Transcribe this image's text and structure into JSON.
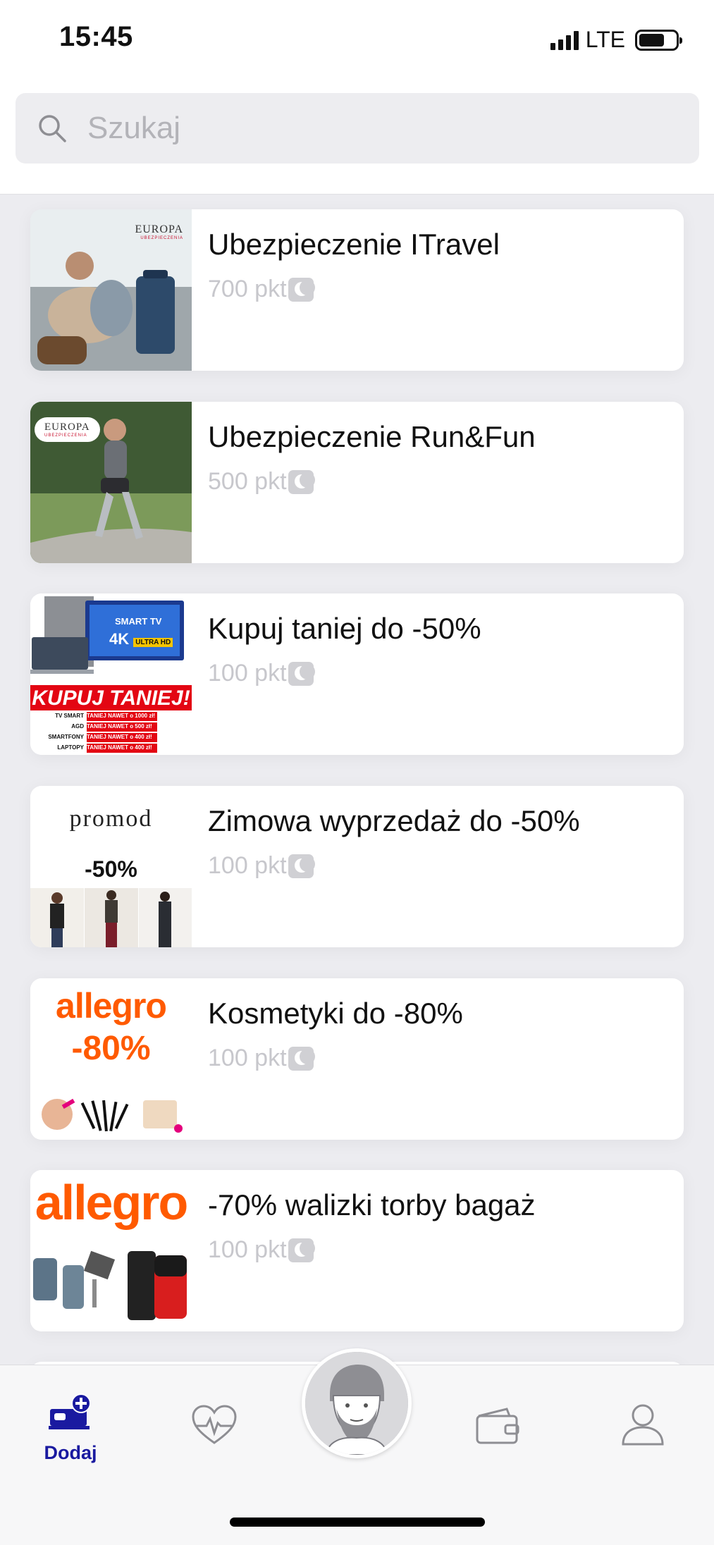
{
  "status": {
    "time": "15:45",
    "network": "LTE"
  },
  "search": {
    "placeholder": "Szukaj"
  },
  "items": [
    {
      "title": "Ubezpieczenie ITravel",
      "price": "700 pkt",
      "thumb_logo": "EUROPA",
      "thumb_sub": "UBEZPIECZENIA"
    },
    {
      "title": "Ubezpieczenie Run&Fun",
      "price": "500 pkt",
      "thumb_logo": "EUROPA",
      "thumb_sub": "UBEZPIECZENIA"
    },
    {
      "title": "Kupuj taniej do -50%",
      "price": "100 pkt",
      "thumb_banner": "KUPUJ TANIEJ!",
      "thumb_tv": "SMART TV",
      "thumb_4k": "4K",
      "thumb_ultra": "ULTRA HD",
      "thumb_lines": [
        {
          "label": "TV SMART",
          "value": "TANIEJ NAWET o 1000 zł!"
        },
        {
          "label": "AGD",
          "value": "TANIEJ NAWET o 500 zł!"
        },
        {
          "label": "SMARTFONY",
          "value": "TANIEJ NAWET o 400 zł!"
        },
        {
          "label": "LAPTOPY",
          "value": "TANIEJ NAWET o 400 zł!"
        }
      ]
    },
    {
      "title": "Zimowa wyprzedaż do -50%",
      "price": "100 pkt",
      "thumb_logo": "promod",
      "thumb_discount": "-50%"
    },
    {
      "title": "Kosmetyki do -80%",
      "price": "100 pkt",
      "thumb_logo": "allegro",
      "thumb_discount": "-80%"
    },
    {
      "title": "-70% walizki torby bagaż",
      "price": "100 pkt",
      "thumb_logo": "allegro"
    }
  ],
  "tabbar": {
    "add_label": "Dodaj",
    "active_color": "#1a1aa0"
  },
  "colors": {
    "allegro_orange": "#ff5a00",
    "europa_red": "#c8102e"
  }
}
